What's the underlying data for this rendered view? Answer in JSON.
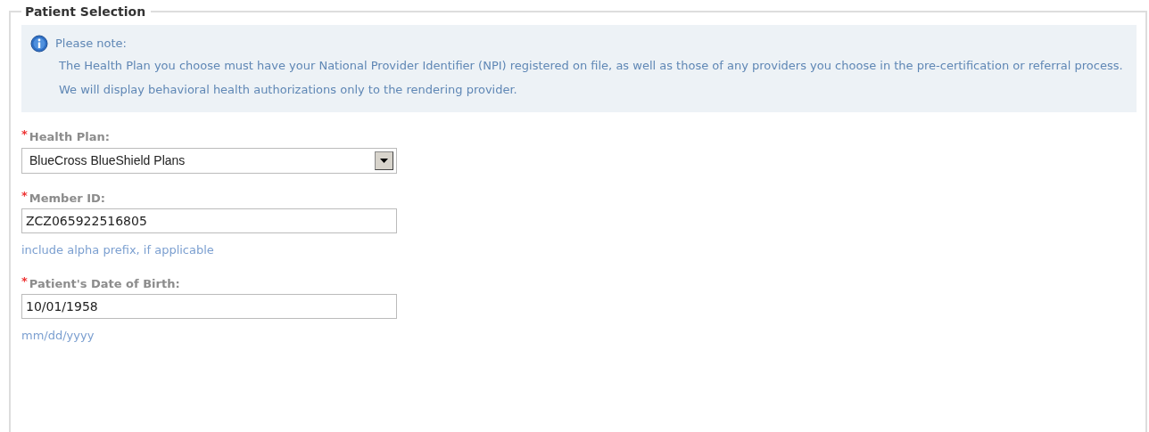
{
  "section": {
    "title": "Patient Selection"
  },
  "notice": {
    "heading": "Please note:",
    "paragraphs": [
      "The Health Plan you choose must have your National Provider Identifier (NPI) registered on file, as well as those of any providers you choose in the pre-certification or referral process.",
      "We will display behavioral health authorizations only to the rendering provider."
    ]
  },
  "fields": [
    {
      "kind": "select",
      "required_mark": "*",
      "label": "Health Plan:",
      "value": "BlueCross BlueShield Plans"
    },
    {
      "kind": "text",
      "required_mark": "*",
      "label": "Member ID:",
      "value": "ZCZ065922516805",
      "hint": "include alpha prefix, if applicable"
    },
    {
      "kind": "text",
      "required_mark": "*",
      "label": "Patient's Date of Birth:",
      "value": "10/01/1958",
      "hint": "mm/dd/yyyy"
    }
  ]
}
